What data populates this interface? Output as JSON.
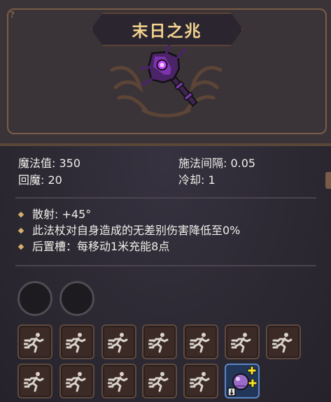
{
  "wand": {
    "name": "末日之兆",
    "corner_mark": "?"
  },
  "stats": {
    "mana": "魔法值: 350",
    "cast_delay": "施法间隔: 0.05",
    "mana_regen": "回魔: 20",
    "cooldown": "冷却: 1"
  },
  "effects": [
    "散射: +45°",
    "此法杖对自身造成的无差别伤害降低至0%",
    "后置槽：每移动1米充能8点"
  ],
  "slots": {
    "empty_circles": 2,
    "row1_icon": "running-man-icon",
    "row2_icon": "running-man-icon",
    "special_icon": "crystal-ball-icon"
  },
  "colors": {
    "title": "#f3d38e",
    "text": "#f1efe9",
    "bullet": "#d7b06c",
    "slot_bg": "#3b2a26",
    "special_border": "#5d86c6",
    "plus": "#f4e12a"
  }
}
